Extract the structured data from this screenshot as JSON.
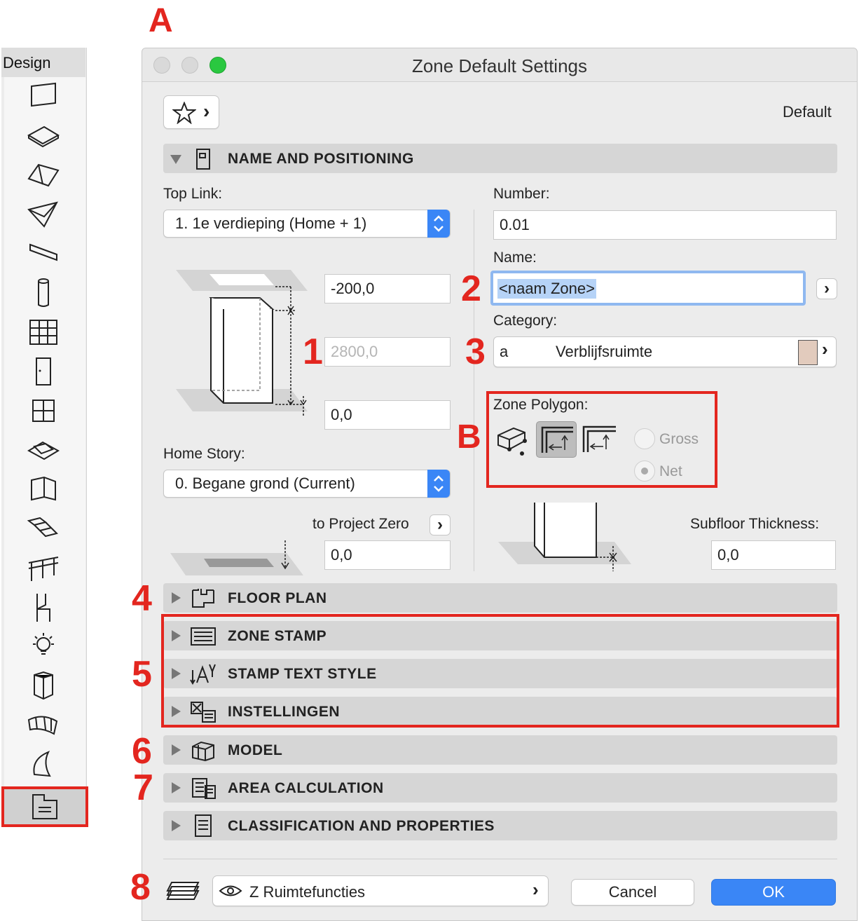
{
  "annotations": {
    "A": "A",
    "B": "B",
    "n1": "1",
    "n2": "2",
    "n3": "3",
    "n4": "4",
    "n5": "5",
    "n6": "6",
    "n7": "7",
    "n8": "8",
    "color": "#e3261f"
  },
  "palette": {
    "title": "Design",
    "tools": [
      "wall-tool-icon",
      "slab-tool-icon",
      "roof-tool-icon",
      "shell-tool-icon",
      "beam-tool-icon",
      "column-tool-icon",
      "curtain-wall-tool-icon",
      "door-tool-icon",
      "window-tool-icon",
      "skylight-tool-icon",
      "corner-window-tool-icon",
      "stair-tool-icon",
      "railing-tool-icon",
      "object-tool-icon",
      "lamp-tool-icon",
      "wall-end-tool-icon",
      "mesh-tool-icon",
      "morph-tool-icon"
    ],
    "selected_tool": "zone-tool-icon"
  },
  "dialog": {
    "title": "Zone Default Settings",
    "traffic_colors": [
      "#d9d9d9",
      "#d9d9d9",
      "#2ac840"
    ],
    "favorites_icon": "star-icon",
    "favorites_chevron": "›",
    "default_label": "Default",
    "sections": {
      "name_positioning": "NAME AND POSITIONING",
      "floor_plan": "FLOOR PLAN",
      "zone_stamp": "ZONE STAMP",
      "stamp_text_style": "STAMP TEXT STYLE",
      "instellingen": "INSTELLINGEN",
      "model": "MODEL",
      "area_calculation": "AREA CALCULATION",
      "classification": "CLASSIFICATION AND PROPERTIES"
    },
    "top_link": {
      "label": "Top Link:",
      "value": "1. 1e verdieping (Home + 1)"
    },
    "top_offset": "-200,0",
    "height": "2800,0",
    "bottom_offset": "0,0",
    "home_story": {
      "label": "Home Story:",
      "value": "0. Begane grond (Current)"
    },
    "to_project_zero": {
      "label": "to Project Zero",
      "chevron": "›",
      "value": "0,0"
    },
    "number": {
      "label": "Number:",
      "value": "0.01"
    },
    "name": {
      "label": "Name:",
      "value": "<naam Zone>",
      "chevron": "›"
    },
    "category": {
      "label": "Category:",
      "code": "a",
      "value": "Verblijfsruimte",
      "swatch": "#e2cbbd",
      "chevron": "›"
    },
    "zone_polygon": {
      "label": "Zone Polygon:",
      "gross": "Gross",
      "net": "Net"
    },
    "subfloor": {
      "label": "Subfloor Thickness:",
      "value": "0,0"
    },
    "footer": {
      "layer_value": "Z Ruimtefuncties",
      "layer_chevron": "›",
      "cancel": "Cancel",
      "ok": "OK",
      "ok_color": "#3a86f6"
    }
  }
}
